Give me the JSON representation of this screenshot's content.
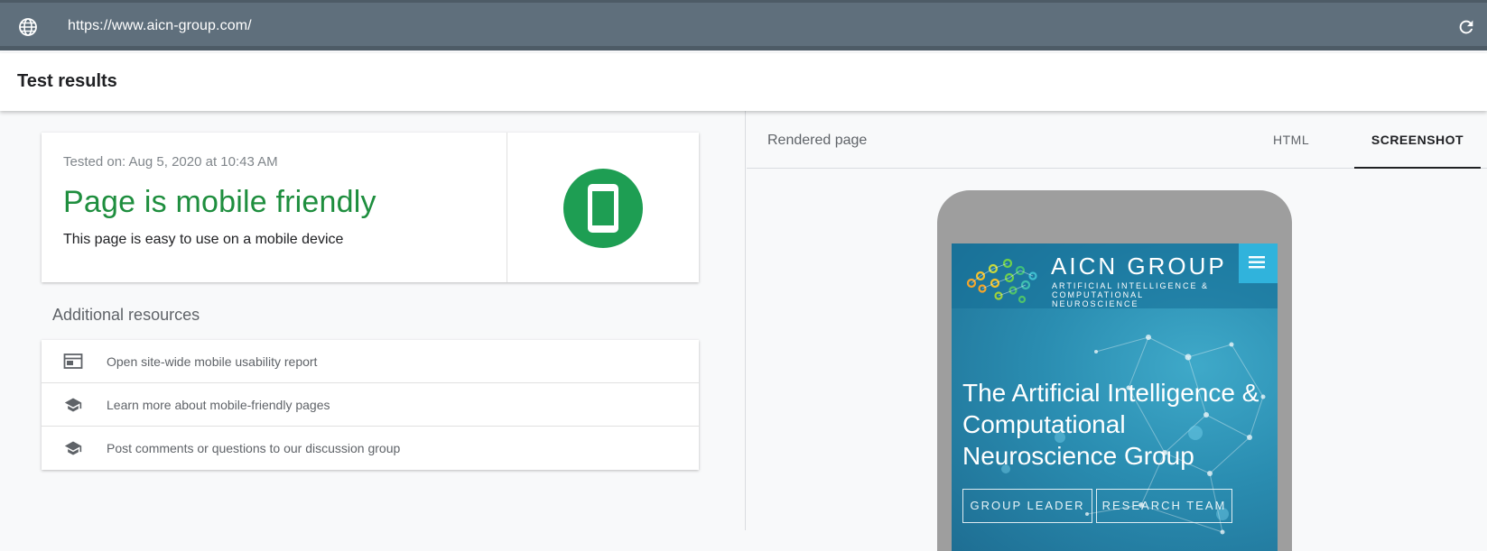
{
  "browser": {
    "url": "https://www.aicn-group.com/",
    "icons": {
      "globe": "globe-icon",
      "reload": "reload-icon"
    }
  },
  "header": {
    "title": "Test results"
  },
  "result": {
    "tested_on": "Tested on: Aug 5, 2020 at 10:43 AM",
    "title": "Page is mobile friendly",
    "subtitle": "This page is easy to use on a mobile device",
    "status_color": "#1e8e3e",
    "badge_icon": "smartphone-icon"
  },
  "resources": {
    "title": "Additional resources",
    "items": [
      {
        "label": "Open site-wide mobile usability report",
        "icon": "report-icon"
      },
      {
        "label": "Learn more about mobile-friendly pages",
        "icon": "school-icon"
      },
      {
        "label": "Post comments or questions to our discussion group",
        "icon": "school-icon"
      }
    ]
  },
  "rendered": {
    "label": "Rendered page",
    "tabs": [
      {
        "label": "HTML",
        "selected": false
      },
      {
        "label": "SCREENSHOT",
        "selected": true
      }
    ],
    "site": {
      "name": "AICN GROUP",
      "tagline": "ARTIFICIAL INTELLIGENCE & COMPUTATIONAL NEUROSCIENCE",
      "heading": "The Artificial Intelligence & Computational Neuroscience Group",
      "buttons": [
        "GROUP LEADER",
        "RESEARCH TEAM"
      ],
      "accent_color": "#30b3dc",
      "menu_icon": "hamburger-menu-icon"
    }
  }
}
